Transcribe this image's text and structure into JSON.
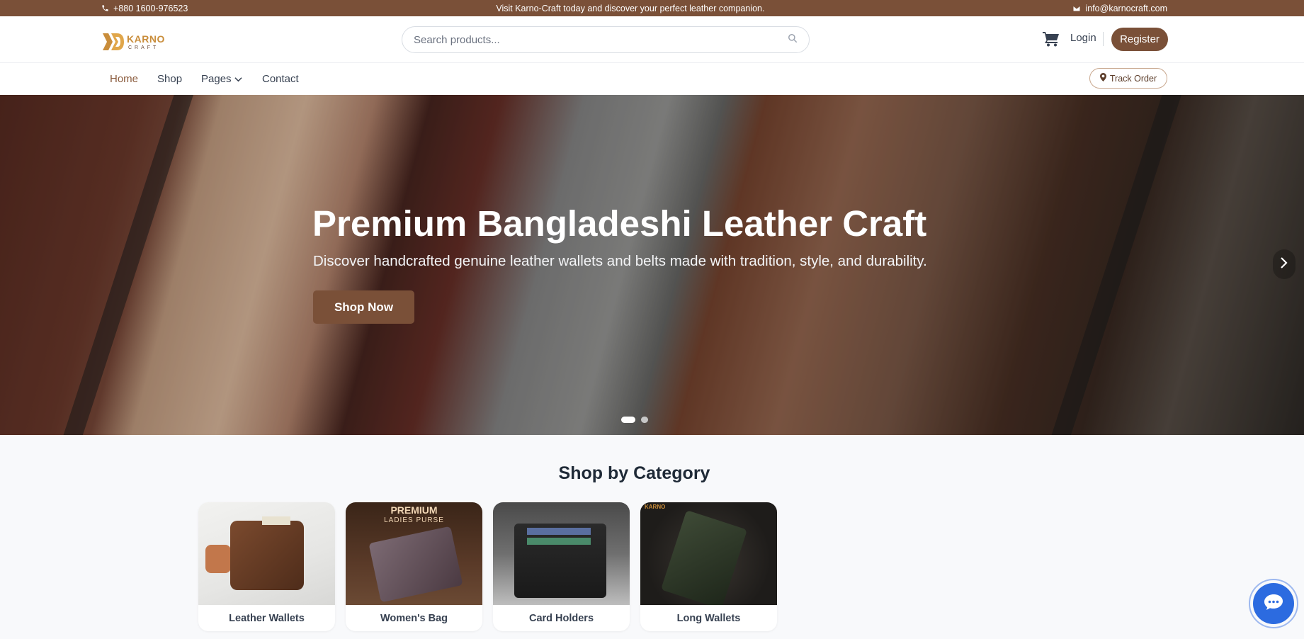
{
  "topbar": {
    "phone": "+880 1600-976523",
    "announcement": "Visit Karno-Craft today and discover your perfect leather companion.",
    "email": "info@karnocraft.com"
  },
  "header": {
    "logo_text": "KARNO",
    "logo_subtext": "CRAFT",
    "search_placeholder": "Search products...",
    "login_label": "Login",
    "register_label": "Register"
  },
  "nav": {
    "items": [
      {
        "label": "Home",
        "active": true
      },
      {
        "label": "Shop",
        "active": false
      },
      {
        "label": "Pages",
        "active": false,
        "has_dropdown": true
      },
      {
        "label": "Contact",
        "active": false
      }
    ],
    "track_order_label": "Track Order"
  },
  "hero": {
    "title": "Premium Bangladeshi Leather Craft",
    "subtitle": "Discover handcrafted genuine leather wallets and belts made with tradition, style, and durability.",
    "cta_label": "Shop Now",
    "slide_count": 2,
    "active_slide": 1
  },
  "categories": {
    "title": "Shop by Category",
    "items": [
      {
        "label": "Leather Wallets"
      },
      {
        "label": "Women's Bag",
        "image_text_top": "PREMIUM",
        "image_text_sub": "LADIES PURSE"
      },
      {
        "label": "Card Holders"
      },
      {
        "label": "Long Wallets",
        "image_text_top": "KARNO"
      }
    ]
  },
  "colors": {
    "brand_brown": "#7a5038",
    "accent_gold": "#c98d3b",
    "chat_blue": "#2c6be0"
  },
  "icons": [
    "phone-icon",
    "mail-icon",
    "search-icon",
    "cart-icon",
    "chevron-down-icon",
    "location-pin-icon",
    "chevron-right-icon",
    "chat-icon"
  ]
}
